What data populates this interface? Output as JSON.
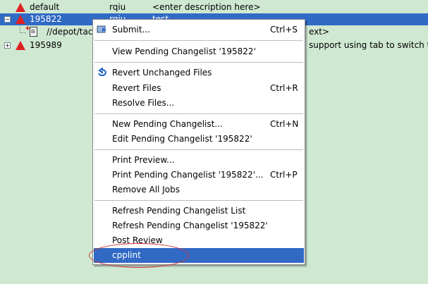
{
  "tree": {
    "rows": [
      {
        "name": "default",
        "user": "rqiu",
        "desc": "<enter description here>"
      },
      {
        "name": "195822",
        "user": "rqiu",
        "desc": "test"
      },
      {
        "name": "//depot/tac",
        "desc_tail": "ext>"
      },
      {
        "name": "195989",
        "desc_tail": "support using tab to switch to"
      }
    ]
  },
  "menu": {
    "items": [
      {
        "label": "Submit...",
        "shortcut": "Ctrl+S",
        "icon": "submit-icon"
      },
      {
        "label": "View Pending Changelist '195822'"
      },
      {
        "label": "Revert Unchanged Files",
        "icon": "revert-icon"
      },
      {
        "label": "Revert Files",
        "shortcut": "Ctrl+R"
      },
      {
        "label": "Resolve Files..."
      },
      {
        "label": "New Pending Changelist...",
        "shortcut": "Ctrl+N"
      },
      {
        "label": "Edit Pending Changelist '195822'"
      },
      {
        "label": "Print Preview..."
      },
      {
        "label": "Print Pending Changelist '195822'...",
        "shortcut": "Ctrl+P"
      },
      {
        "label": "Remove All Jobs"
      },
      {
        "label": "Refresh Pending Changelist List"
      },
      {
        "label": "Refresh Pending Changelist '195822'"
      },
      {
        "label": "Post Review"
      },
      {
        "label": "cpplint"
      }
    ]
  },
  "colors": {
    "background": "#cfe8d2",
    "selection": "#316ac5",
    "annotation": "#d03030"
  }
}
